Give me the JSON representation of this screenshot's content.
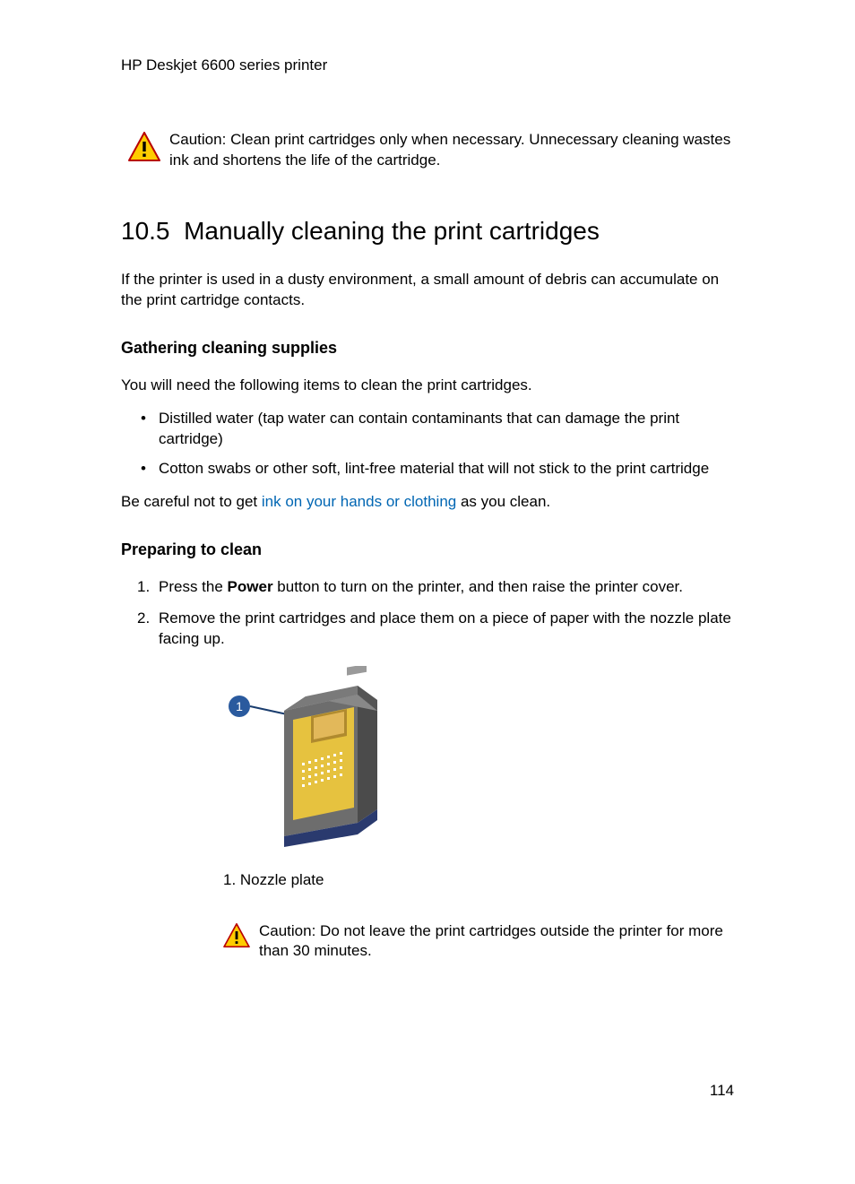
{
  "header": {
    "product": "HP Deskjet 6600 series printer"
  },
  "topCaution": {
    "label": "Caution:",
    "text": "Clean print cartridges only when necessary. Unnecessary cleaning wastes ink and shortens the life of the cartridge."
  },
  "section": {
    "number": "10.5",
    "title": "Manually cleaning the print cartridges",
    "intro": "If the printer is used in a dusty environment, a small amount of debris can accumulate on the print cartridge contacts."
  },
  "supplies": {
    "heading": "Gathering cleaning supplies",
    "lead": "You will need the following items to clean the print cartridges.",
    "items": [
      "Distilled water (tap water can contain contaminants that can damage the print cartridge)",
      "Cotton swabs or other soft, lint-free material that will not stick to the print cartridge"
    ],
    "careful_prefix": "Be careful not to get ",
    "careful_link": "ink on your hands or clothing",
    "careful_suffix": " as you clean."
  },
  "preparing": {
    "heading": "Preparing to clean",
    "step1_prefix": "Press the ",
    "step1_bold": "Power",
    "step1_suffix": " button to turn on the printer, and then raise the printer cover.",
    "step2": "Remove the print cartridges and place them on a piece of paper with the nozzle plate facing up.",
    "figure_caption": "1. Nozzle plate",
    "caution_label": "Caution:",
    "caution_text": " Do not leave the print cartridges outside the printer for more than 30 minutes."
  },
  "pageNumber": "114"
}
